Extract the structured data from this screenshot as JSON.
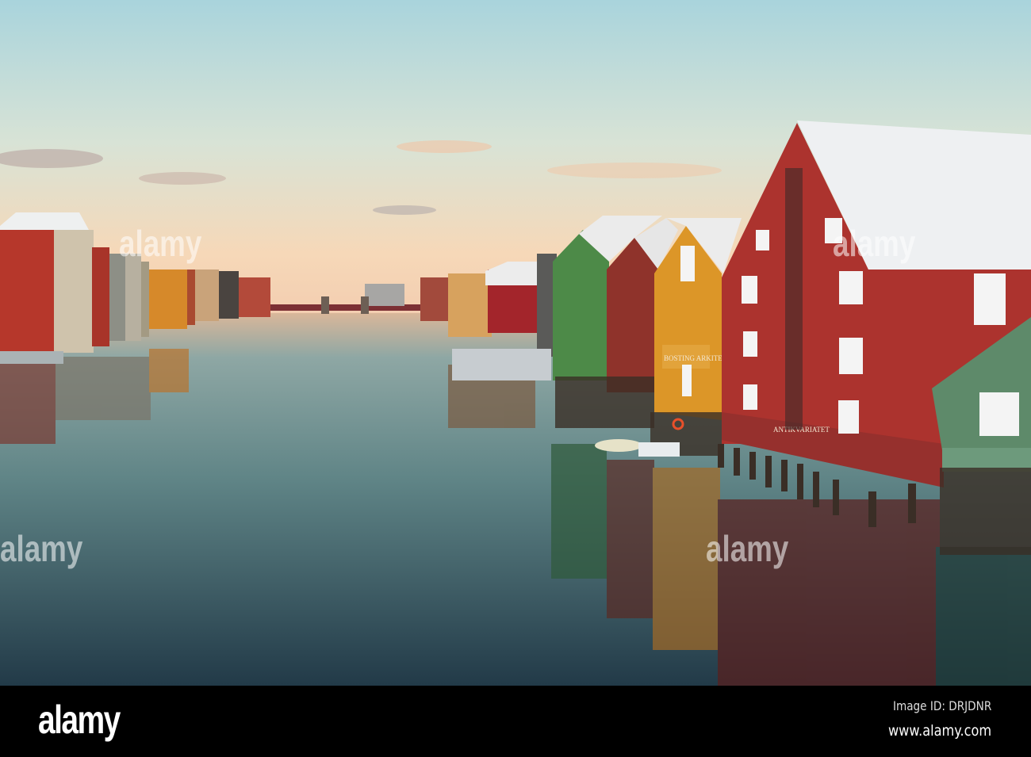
{
  "photo": {
    "signs": {
      "orange_building": "BOSTING ARKITEKTER AS",
      "red_building": "ANTIKVARIATET"
    },
    "watermark": "alamy",
    "colors": {
      "sky_top": "#b9dbe0",
      "sky_horizon": "#f6d9b6",
      "water": "#3f5e66",
      "red_house": "#a8322e",
      "orange_house": "#d9922a",
      "green_house": "#4f8a4a"
    }
  },
  "footer": {
    "logo": "alamy",
    "image_id": "Image ID: DRJDNR",
    "url": "www.alamy.com"
  }
}
